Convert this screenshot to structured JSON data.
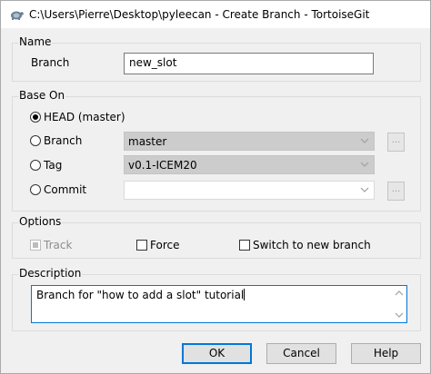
{
  "window": {
    "title": "C:\\Users\\Pierre\\Desktop\\pyleecan - Create Branch - TortoiseGit",
    "icon": "tortoisegit-icon"
  },
  "name_group": {
    "label": "Name",
    "branch_label": "Branch",
    "branch_value": "new_slot"
  },
  "base_on": {
    "label": "Base On",
    "head_label": "HEAD (master)",
    "branch_label": "Branch",
    "branch_value": "master",
    "tag_label": "Tag",
    "tag_value": "v0.1-ICEM20",
    "commit_label": "Commit",
    "commit_value": "",
    "browse_label": "...",
    "selected": "head"
  },
  "options": {
    "label": "Options",
    "track_label": "Track",
    "force_label": "Force",
    "switch_label": "Switch to new branch"
  },
  "description": {
    "label": "Description",
    "value": "Branch for \"how to add a slot\" tutorial"
  },
  "buttons": {
    "ok": "OK",
    "cancel": "Cancel",
    "help": "Help"
  },
  "colors": {
    "accent": "#0078d7",
    "disabled_field": "#cccccc"
  }
}
